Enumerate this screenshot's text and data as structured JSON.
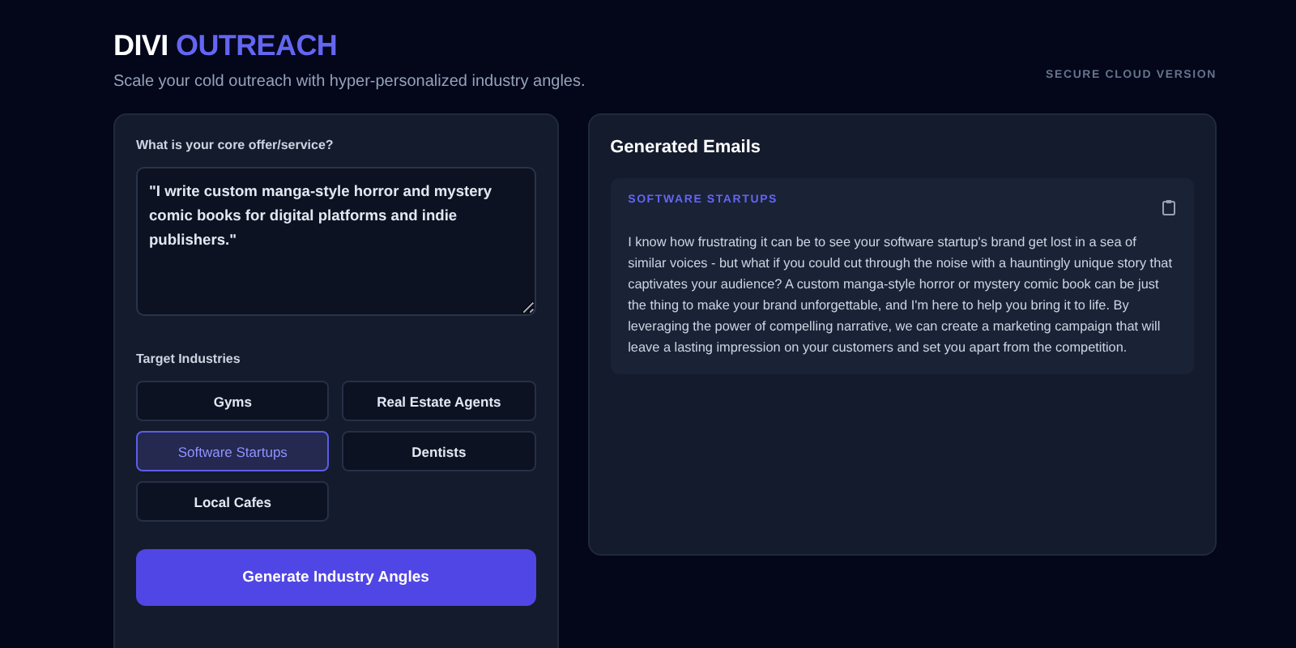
{
  "brand": {
    "first": "DIVI",
    "second": "OUTREACH"
  },
  "tagline": "Scale your cold outreach with hyper-personalized industry angles.",
  "badge": "SECURE CLOUD VERSION",
  "form": {
    "offer_label": "What is your core offer/service?",
    "offer_value": "\"I write custom manga-style horror and mystery comic books for digital platforms and indie publishers.\"",
    "industries_label": "Target Industries",
    "industries": [
      {
        "label": "Gyms",
        "selected": false
      },
      {
        "label": "Real Estate Agents",
        "selected": false
      },
      {
        "label": "Software Startups",
        "selected": true
      },
      {
        "label": "Dentists",
        "selected": false
      },
      {
        "label": "Local Cafes",
        "selected": false
      }
    ],
    "submit": "Generate Industry Angles"
  },
  "results": {
    "title": "Generated Emails",
    "emails": [
      {
        "industry": "SOFTWARE STARTUPS",
        "body": "I know how frustrating it can be to see your software startup's brand get lost in a sea of similar voices - but what if you could cut through the noise with a hauntingly unique story that captivates your audience? A custom manga-style horror or mystery comic book can be just the thing to make your brand unforgettable, and I'm here to help you bring it to life. By leveraging the power of compelling narrative, we can create a marketing campaign that will leave a lasting impression on your customers and set you apart from the competition."
      }
    ]
  }
}
